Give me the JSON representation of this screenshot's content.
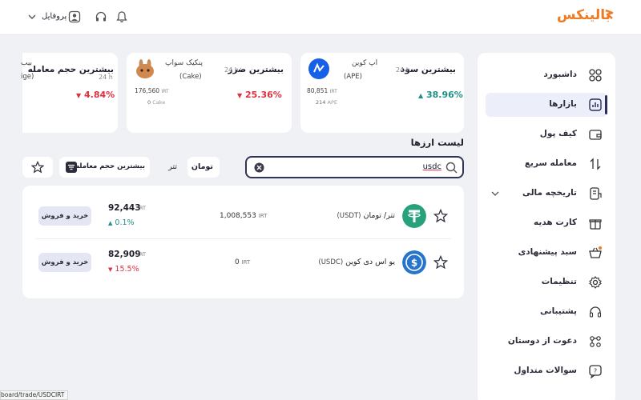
{
  "header": {
    "logo_text": "بالینکس",
    "profile_label": "پروفایل",
    "brand_color": "#f07a22"
  },
  "sidebar": {
    "items": [
      {
        "label": "داشبورد",
        "icon": "dashboard-grid-icon"
      },
      {
        "label": "بازارها",
        "icon": "markets-chart-icon",
        "active": true
      },
      {
        "label": "کیف پول",
        "icon": "wallet-icon"
      },
      {
        "label": "معامله سریع",
        "icon": "swap-arrows-icon"
      },
      {
        "label": "تاریخچه مالی",
        "icon": "history-receipt-icon"
      },
      {
        "label": "کارت هدیه",
        "icon": "gift-icon"
      },
      {
        "label": "سبد پیشنهادی",
        "icon": "basket-icon"
      },
      {
        "label": "تنظیمات",
        "icon": "gear-icon"
      },
      {
        "label": "پشتیبانی",
        "icon": "headset-icon"
      },
      {
        "label": "دعوت از دوستان",
        "icon": "invite-users-icon"
      },
      {
        "label": "سوالات متداول",
        "icon": "faq-icon"
      }
    ]
  },
  "cards": {
    "profit": {
      "title": "بیشترین سود",
      "period": "24 h",
      "coin_name": "اپ کوین",
      "coin_symbol": "(APE)",
      "price": "80,851",
      "price_unit": "IRT",
      "volume": "214",
      "volume_unit": "APE",
      "change": "38.96%"
    },
    "loss": {
      "title": "بیشترین ضرر",
      "period": "24 h",
      "coin_name": "پنکیک سواپ",
      "coin_symbol": "(Cake)",
      "price": "176,560",
      "price_unit": "IRT",
      "volume": "0",
      "volume_unit": "Cake",
      "change": "25.36%"
    },
    "volume": {
      "title": "بیشترین حجم معامله",
      "period": "24 h",
      "coin_name": "بیب",
      "coin_symbol": "ige)",
      "change": "4.84%"
    }
  },
  "list": {
    "title": "لیست ارزها",
    "search_value": "usdc",
    "filters": {
      "toman": "تومان",
      "tether": "تتر",
      "sort": "بیشترین حجم معامله"
    },
    "rows": [
      {
        "name": "تتر/ تومان",
        "symbol": "(USDT)",
        "volume": "1,008,553",
        "volume_unit": "IRT",
        "price": "92,443",
        "price_unit": "IRT",
        "change": "0.1%",
        "trend": "up",
        "button": "خرید و فروش"
      },
      {
        "name": "یو اس دی کوین",
        "symbol": "(USDC)",
        "volume": "0",
        "volume_unit": "IRT",
        "price": "82,909",
        "price_unit": "IRT",
        "change": "15.5%",
        "trend": "down",
        "button": "خرید و فروش"
      }
    ]
  },
  "status_bar": "board/trade/USDCIRT"
}
